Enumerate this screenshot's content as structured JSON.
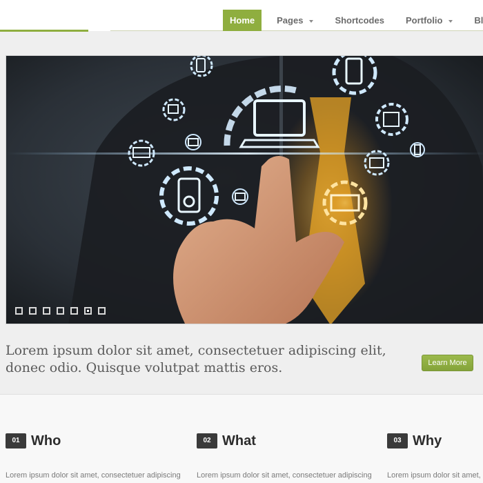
{
  "nav": {
    "items": [
      {
        "label": "Home",
        "active": true,
        "dropdown": false
      },
      {
        "label": "Pages",
        "active": false,
        "dropdown": true
      },
      {
        "label": "Shortcodes",
        "active": false,
        "dropdown": false
      },
      {
        "label": "Portfolio",
        "active": false,
        "dropdown": true
      },
      {
        "label": "Blog",
        "active": false,
        "dropdown": false
      }
    ]
  },
  "slider": {
    "slide_count": 7,
    "active_index": 5,
    "image_subject": "hand-touching-technology-icons",
    "icons": [
      "laptop-icon",
      "phone-icon",
      "tablet-icon",
      "media-player-icon",
      "camera-icon",
      "monitor-icon",
      "video-camera-icon"
    ]
  },
  "intro": {
    "text": "Lorem ipsum dolor sit amet, consectetuer adipiscing elit, donec odio. Quisque volutpat mattis eros.",
    "button_label": "Learn More"
  },
  "columns": [
    {
      "number": "01",
      "title": "Who",
      "text": "Lorem ipsum dolor sit amet, consectetuer adipiscing"
    },
    {
      "number": "02",
      "title": "What",
      "text": "Lorem ipsum dolor sit amet, consectetuer adipiscing"
    },
    {
      "number": "03",
      "title": "Why",
      "text": "Lorem ipsum dolor sit amet, consectetuer adipiscing"
    }
  ],
  "colors": {
    "accent": "#8fae3f",
    "badge": "#3a3a3a",
    "page_bg": "#efefef"
  }
}
